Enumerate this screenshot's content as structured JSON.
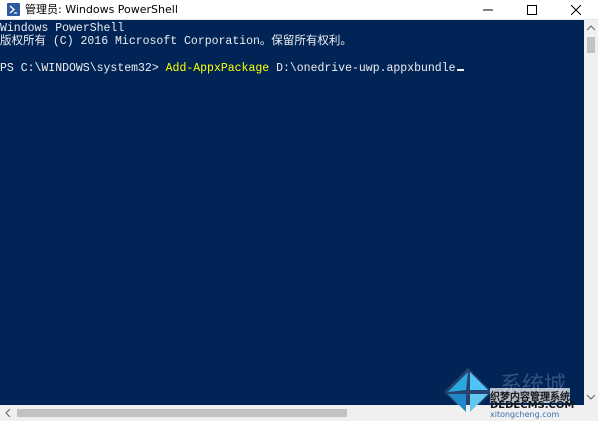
{
  "window": {
    "title": "管理员: Windows PowerShell",
    "icon": "powershell-icon"
  },
  "title_buttons": {
    "minimize": "minimize-icon",
    "maximize": "maximize-icon",
    "close": "close-icon"
  },
  "console": {
    "line1": "Windows PowerShell",
    "line2": "版权所有 (C) 2016 Microsoft Corporation。保留所有权利。",
    "prompt": "PS C:\\WINDOWS\\system32> ",
    "command": "Add-AppxPackage",
    "argument": " D:\\onedrive-uwp.appxbundle"
  },
  "watermark": {
    "text_large": "系统城",
    "text_site1": "织梦内容管理系统",
    "text_site2": "DEDECMS.COM",
    "text_site3": "xitongcheng.com"
  },
  "colors": {
    "console_bg": "#012456",
    "console_fg": "#eeedf0",
    "command_fg": "#ffff00"
  }
}
